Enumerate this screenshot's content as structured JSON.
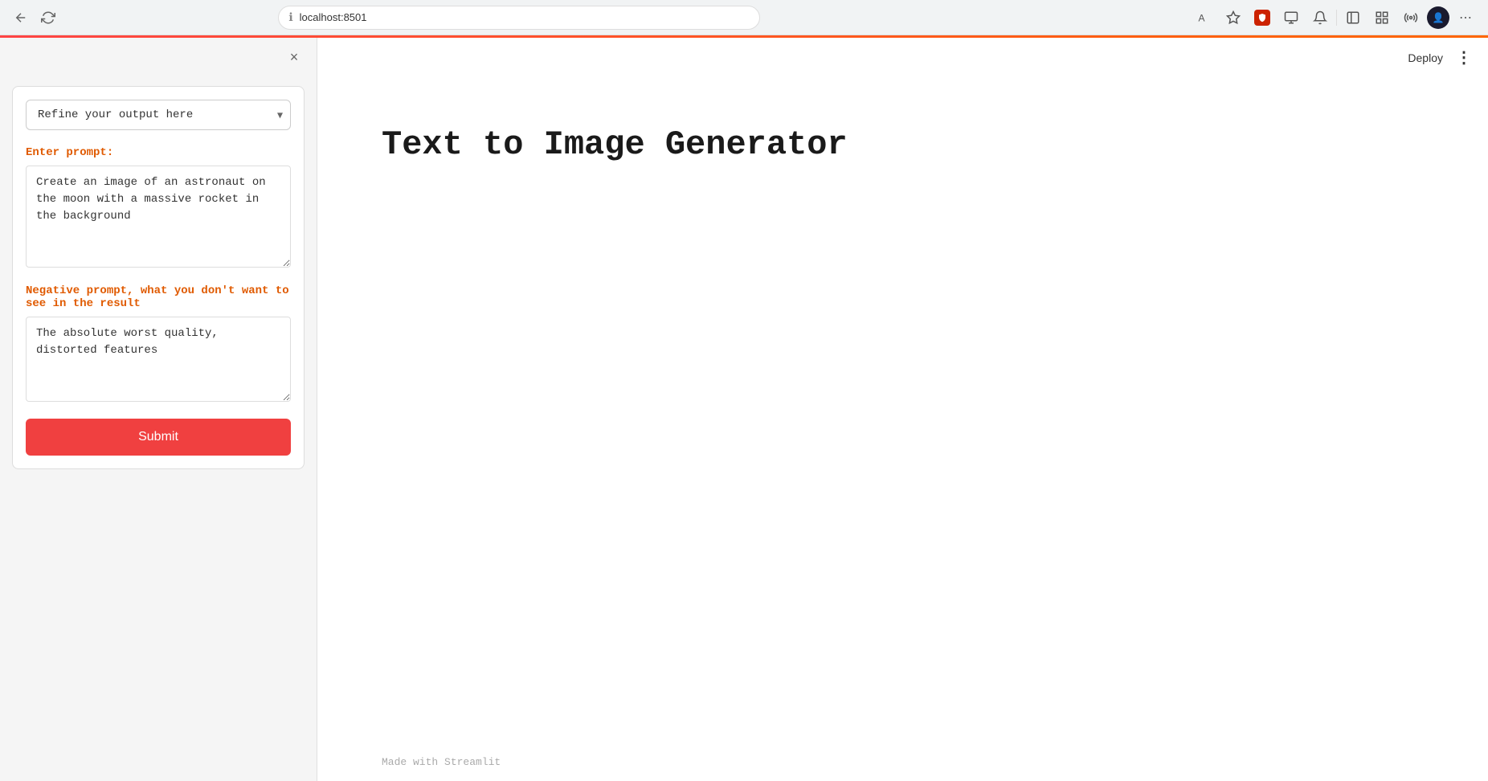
{
  "browser": {
    "url": "localhost:8501",
    "back_label": "←",
    "forward_label": "→",
    "reload_label": "↻",
    "info_label": "ℹ",
    "extensions": {
      "font_icon": "A",
      "star_icon": "☆",
      "shield_icon": "🛡",
      "monitor_icon": "▣",
      "bell_icon": "🔔",
      "sidebar_icon": "▤",
      "grid_icon": "⊞",
      "network_icon": "⚙",
      "more_icon": "⋯"
    },
    "deploy_label": "Deploy",
    "more_label": "⋮"
  },
  "sidebar": {
    "close_label": "×",
    "select": {
      "value": "Refine your output here",
      "options": [
        "Refine your output here"
      ]
    },
    "prompt_label": "Enter prompt:",
    "prompt_value": "Create an image of an astronaut on the moon with a massive rocket in the background",
    "negative_prompt_label": "Negative prompt, what you don't want to see in the result",
    "negative_prompt_value": "The absolute worst quality, distorted features",
    "submit_label": "Submit"
  },
  "main": {
    "title": "Text to Image Generator",
    "footer_text": "Made with ",
    "footer_brand": "Streamlit"
  }
}
